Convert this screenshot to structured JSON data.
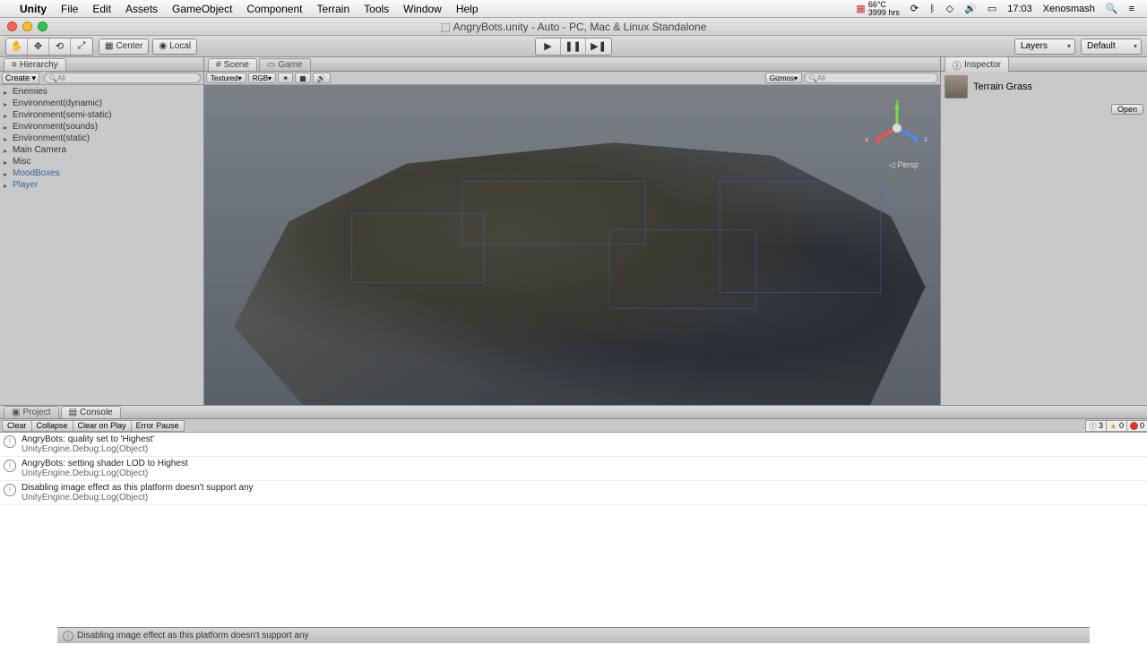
{
  "menubar": {
    "app": "Unity",
    "items": [
      "File",
      "Edit",
      "Assets",
      "GameObject",
      "Component",
      "Terrain",
      "Tools",
      "Window",
      "Help"
    ],
    "weather_temp": "66°C",
    "weather_sub": "3999 hrs",
    "time": "17:03",
    "user": "Xenosmash"
  },
  "titlebar": "AngryBots.unity - Auto - PC, Mac & Linux Standalone",
  "toolbar": {
    "center": "Center",
    "local": "Local",
    "layers": "Layers",
    "layout": "Default"
  },
  "hierarchy": {
    "title": "Hierarchy",
    "create": "Create",
    "search_placeholder": "All",
    "items": [
      {
        "label": "Enemies",
        "prefab": false
      },
      {
        "label": "Environment(dynamic)",
        "prefab": false
      },
      {
        "label": "Environment(semi-static)",
        "prefab": false
      },
      {
        "label": "Environment(sounds)",
        "prefab": false
      },
      {
        "label": "Environment(static)",
        "prefab": false
      },
      {
        "label": "Main Camera",
        "prefab": false
      },
      {
        "label": "Misc",
        "prefab": false
      },
      {
        "label": "MoodBoxes",
        "prefab": true
      },
      {
        "label": "Player",
        "prefab": true
      }
    ]
  },
  "scene": {
    "tab_scene": "Scene",
    "tab_game": "Game",
    "shading": "Textured",
    "rgb": "RGB",
    "gizmos": "Gizmos",
    "search_placeholder": "All",
    "persp": "Persp",
    "axes": {
      "x": "x",
      "y": "y",
      "z": "z"
    }
  },
  "inspector": {
    "title": "Inspector",
    "asset_name": "Terrain Grass",
    "open": "Open"
  },
  "bottom": {
    "tab_project": "Project",
    "tab_console": "Console",
    "btn_clear": "Clear",
    "btn_collapse": "Collapse",
    "btn_clear_play": "Clear on Play",
    "btn_error_pause": "Error Pause",
    "info_count": "3",
    "warn_count": "0",
    "err_count": "0",
    "logs": [
      {
        "l1": "AngryBots: quality set to 'Highest'",
        "l2": "UnityEngine.Debug:Log(Object)"
      },
      {
        "l1": "AngryBots: setting shader LOD to Highest",
        "l2": "UnityEngine.Debug:Log(Object)"
      },
      {
        "l1": "Disabling image effect as this platform doesn't support any",
        "l2": "UnityEngine.Debug:Log(Object)"
      }
    ]
  },
  "status": "Disabling image effect as this platform doesn't support any"
}
